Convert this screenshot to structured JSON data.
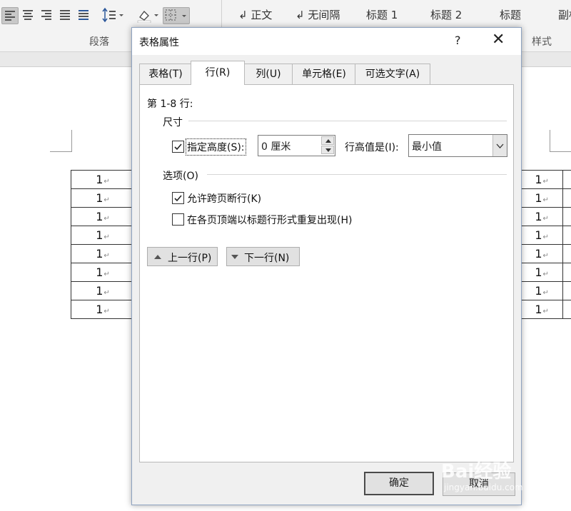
{
  "ribbon": {
    "styles": [
      "↲ 正文",
      "↲ 无间隔",
      "标题 1",
      "标题 2",
      "标题",
      "副标"
    ],
    "paragraph_group": "段落",
    "styles_group": "样式"
  },
  "document": {
    "table_cell": "1",
    "return_mark": "↵"
  },
  "dialog": {
    "title": "表格属性",
    "help": "?",
    "close": "✕",
    "tabs": [
      "表格(T)",
      "行(R)",
      "列(U)",
      "单元格(E)",
      "可选文字(A)"
    ],
    "active_tab": "行(R)",
    "rows_label": "第 1-8 行:",
    "size_section": "尺寸",
    "specify_height": {
      "label": "指定高度(S):",
      "checked": true
    },
    "height_value": "0 厘米",
    "height_rule_label": "行高值是(I):",
    "height_rule_value": "最小值",
    "options_section": "选项(O)",
    "allow_break": {
      "label": "允许跨页断行(K)",
      "checked": true
    },
    "repeat_header": {
      "label": "在各页顶端以标题行形式重复出现(H)",
      "checked": false
    },
    "prev_row": "上一行(P)",
    "next_row": "下一行(N)",
    "ok": "确定",
    "cancel": "取消"
  },
  "watermark": {
    "brand": "Bai经验",
    "url": "jingyan.baidu.com"
  },
  "colors": {
    "arrow": "#e640e6",
    "accent": "#2b579a"
  }
}
